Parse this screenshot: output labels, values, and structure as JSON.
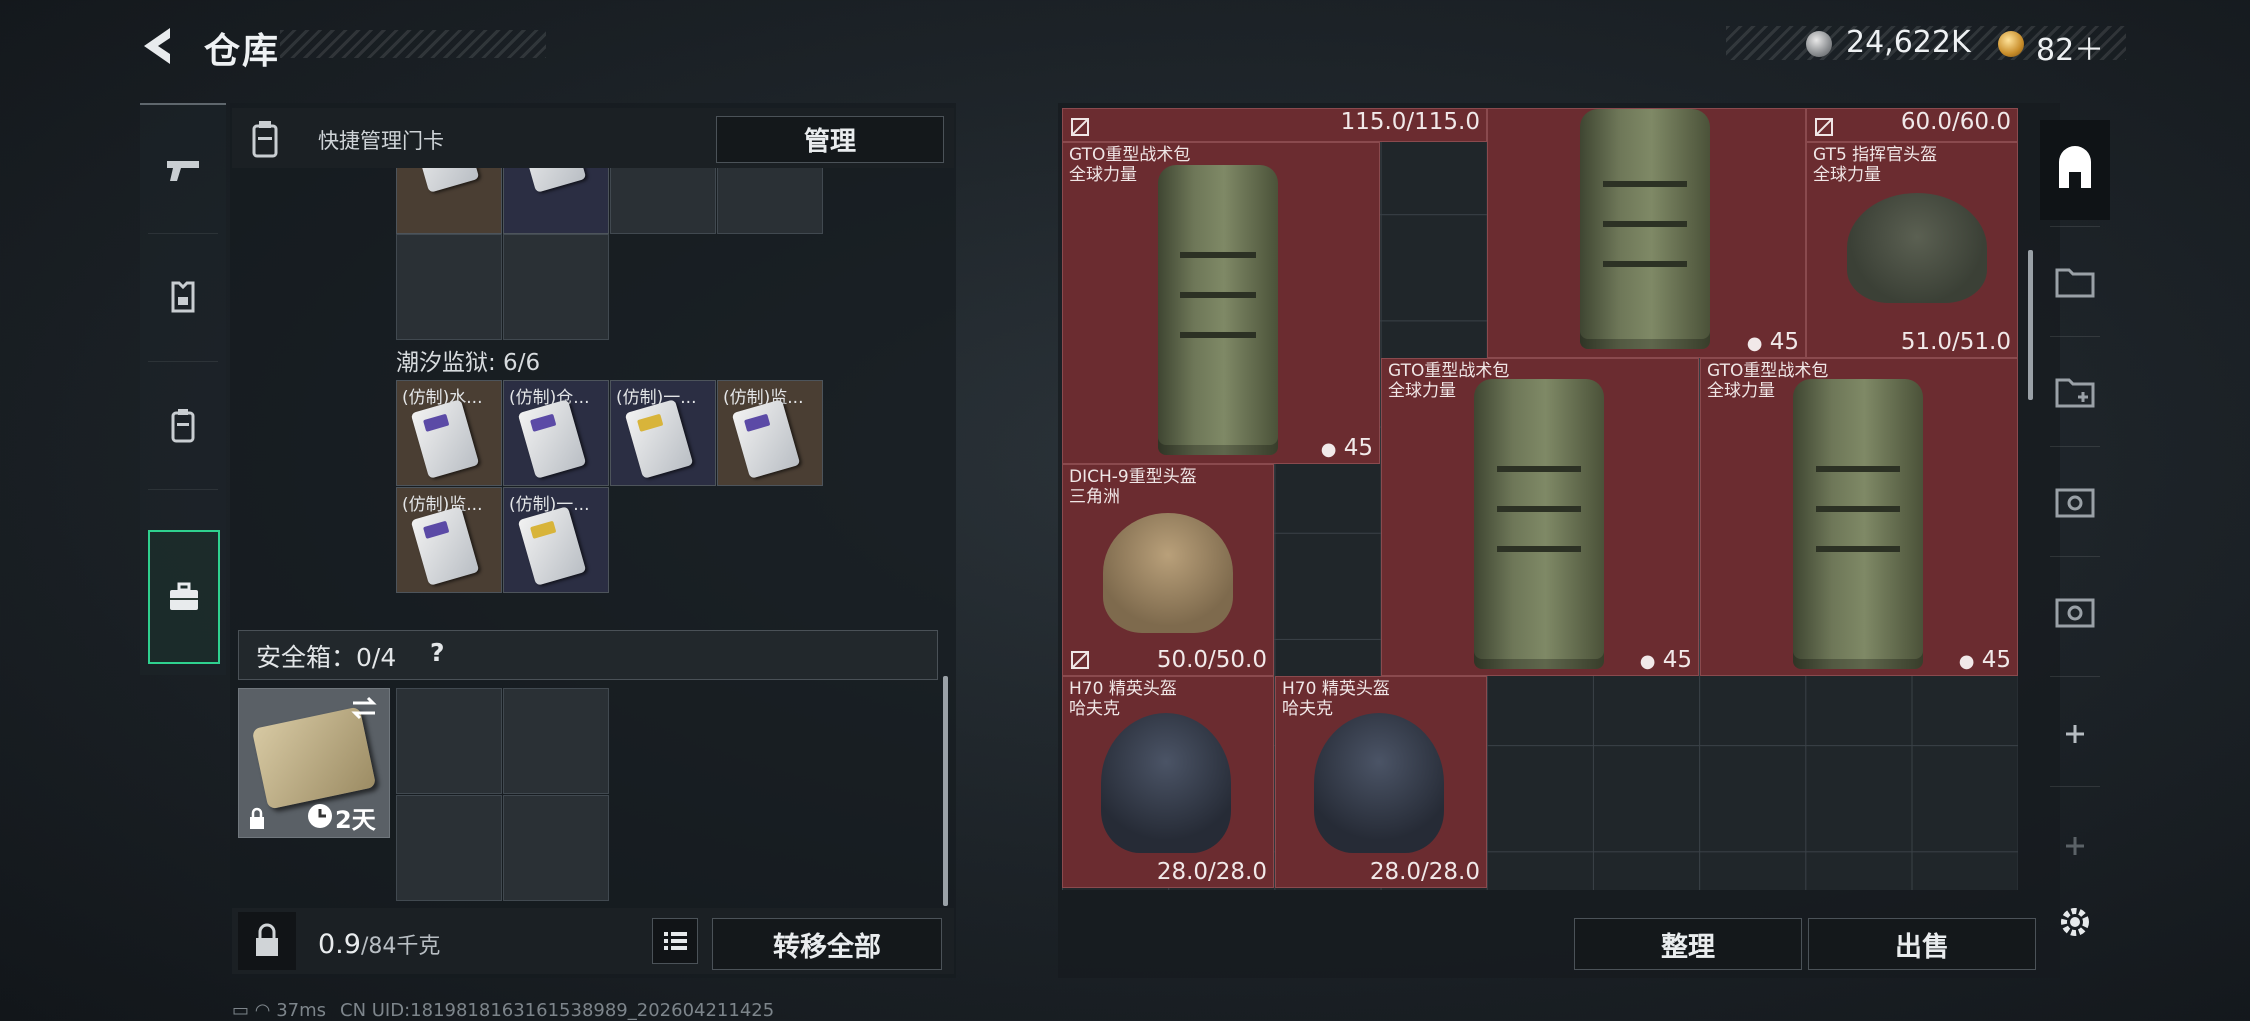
{
  "header": {
    "title": "仓库",
    "currency_coins": "24,622K",
    "currency_tokens": "82＋"
  },
  "quick_manage": {
    "label": "快捷管理门卡",
    "button": "管理"
  },
  "tidal_prison": {
    "label": "潮汐监狱: 6/6",
    "cards": [
      {
        "name": "(仿制)水..."
      },
      {
        "name": "(仿制)仓..."
      },
      {
        "name": "(仿制)一..."
      },
      {
        "name": "(仿制)监..."
      },
      {
        "name": "(仿制)监..."
      },
      {
        "name": "(仿制)一..."
      }
    ]
  },
  "safe_box": {
    "label": "安全箱：0/4",
    "help": "?",
    "timer": "2天"
  },
  "left_footer": {
    "weight": "0.9",
    "weight_unit": "/84千克",
    "transfer_button": "转移全部"
  },
  "stash_items": [
    {
      "name": "GTO重型战术包",
      "brand": "全球力量",
      "count": "45"
    },
    {
      "name": "",
      "brand": "",
      "count": "45"
    },
    {
      "name": "GT5 指挥官头盔",
      "brand": "全球力量",
      "durability": "51.0/51.0"
    },
    {
      "name": "GTO重型战术包",
      "brand": "全球力量",
      "count": "45"
    },
    {
      "name": "GTO重型战术包",
      "brand": "全球力量",
      "count": "45"
    },
    {
      "name": "DICH-9重型头盔",
      "brand": "三角洲",
      "durability": "50.0/50.0"
    },
    {
      "name": "H70 精英头盔",
      "brand": "哈夫克",
      "durability": "28.0/28.0"
    },
    {
      "name": "H70 精英头盔",
      "brand": "哈夫克",
      "durability": "28.0/28.0"
    }
  ],
  "top_row_values": {
    "first": "115.0/115.0",
    "second": "60.0/60.0"
  },
  "right_buttons": {
    "tidy": "整理",
    "sell": "出售"
  },
  "footer": {
    "latency": "37ms",
    "uid": "CN UID:1819818163161538989_202604211425"
  }
}
